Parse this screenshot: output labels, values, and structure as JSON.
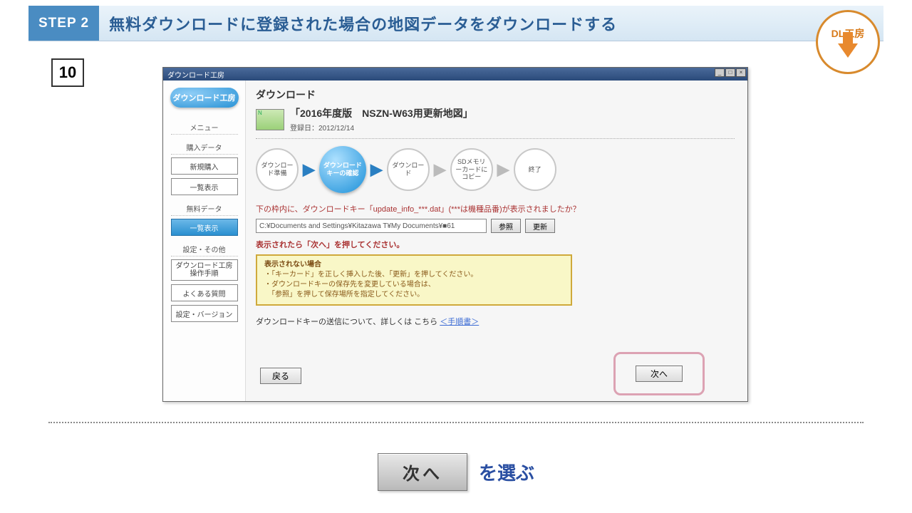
{
  "header": {
    "step_label": "STEP 2",
    "title": "無料ダウンロードに登録された場合の地図データをダウンロードする"
  },
  "logo": {
    "text": "DL工房"
  },
  "step_number": "10",
  "window": {
    "title": "ダウンロード工房",
    "controls": {
      "min": "_",
      "max": "□",
      "close": "×"
    }
  },
  "sidebar": {
    "brand": "ダウンロード工房",
    "group_menu": "メニュー",
    "group_purchase": "購入データ",
    "btn_purchase_new": "新規購入",
    "btn_purchase_list": "一覧表示",
    "group_free": "無料データ",
    "btn_free_list": "一覧表示",
    "group_settings": "設定・その他",
    "btn_manual": "ダウンロード工房 操作手順",
    "btn_faq": "よくある質問",
    "btn_version": "設定・バージョン"
  },
  "main": {
    "section_title": "ダウンロード",
    "item_title": "「2016年度版　NSZN-W63用更新地図」",
    "item_date_label": "登録日：2012/12/14",
    "flow": {
      "s1": "ダウンロード準備",
      "s2": "ダウンロードキーの確認",
      "s3": "ダウンロード",
      "s4": "SDメモリーカードにコピー",
      "s5": "終了"
    },
    "prompt": "下の枠内に、ダウンロードキー「update_info_***.dat」(***は機種品番)が表示されましたか？",
    "path_value": "C:¥Documents and Settings¥Kitazawa T¥My Documents¥■61",
    "btn_browse": "参照",
    "btn_refresh": "更新",
    "next_instr": "表示されたら「次へ」を押してください。",
    "warn_title": "表示されない場合",
    "warn_line1": "・「キーカード」を正しく挿入した後、「更新」を押してください。",
    "warn_line2": "・ダウンロードキーの保存先を変更している場合は、",
    "warn_line3": "　「参照」を押して保存場所を指定してください。",
    "link_prefix": "ダウンロードキーの送信について、詳しくは こちら ",
    "link_text": "＜手順書＞",
    "btn_back": "戻る",
    "btn_next": "次へ"
  },
  "bottom": {
    "next_button": "次へ",
    "caption": "を選ぶ"
  }
}
